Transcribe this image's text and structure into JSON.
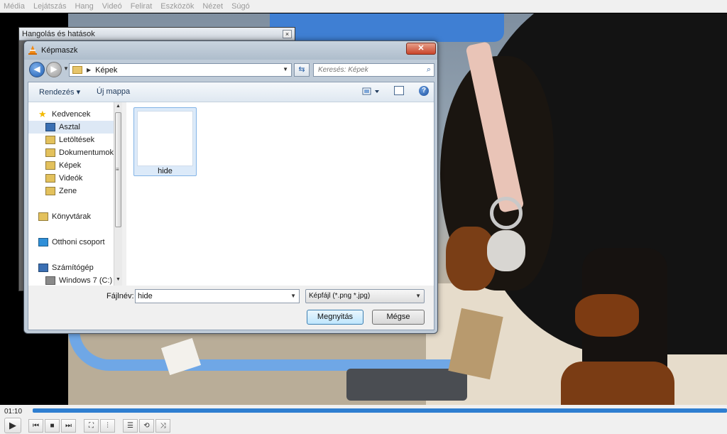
{
  "menubar": {
    "items": [
      "Média",
      "Lejátszás",
      "Hang",
      "Videó",
      "Felirat",
      "Eszközök",
      "Nézet",
      "Súgó"
    ]
  },
  "player": {
    "elapsed": "01:10",
    "progress_fraction": 1.0,
    "accent_color": "#2f7fd1",
    "buttons": {
      "play": "play-icon",
      "previous": "skip-previous-icon",
      "stop": "stop-icon",
      "next": "skip-next-icon",
      "fullscreen": "fullscreen-icon",
      "extended_settings": "equalizer-icon",
      "playlist": "playlist-icon",
      "loop": "loop-icon",
      "shuffle": "shuffle-icon"
    }
  },
  "effects_window": {
    "title": "Hangolás és hatások",
    "close": "×"
  },
  "dialog": {
    "title": "Képmaszk",
    "close": "✕",
    "address": "Képek",
    "search_placeholder": "Keresés: Képek",
    "toolbar": {
      "organize": "Rendezés ▾",
      "new_folder": "Új mappa"
    },
    "nav_items": [
      {
        "label": "Kedvencek",
        "icon": "star-icon",
        "indent": 0,
        "color": "#f2b900"
      },
      {
        "label": "Asztal",
        "icon": "desktop-icon",
        "indent": 1,
        "color": "#3a6fb3",
        "selected": true
      },
      {
        "label": "Letöltések",
        "icon": "downloads-folder-icon",
        "indent": 1,
        "color": "#e3c15c"
      },
      {
        "label": "Dokumentumok",
        "icon": "documents-folder-icon",
        "indent": 1,
        "color": "#e3c15c"
      },
      {
        "label": "Képek",
        "icon": "pictures-folder-icon",
        "indent": 1,
        "color": "#e3c15c"
      },
      {
        "label": "Videók",
        "icon": "videos-folder-icon",
        "indent": 1,
        "color": "#e3c15c"
      },
      {
        "label": "Zene",
        "icon": "music-folder-icon",
        "indent": 1,
        "color": "#e3c15c"
      },
      {
        "label": "Könyvtárak",
        "icon": "libraries-icon",
        "indent": 0,
        "color": "#e3c15c"
      },
      {
        "label": "Otthoni csoport",
        "icon": "homegroup-icon",
        "indent": 0,
        "color": "#2f8fd8"
      },
      {
        "label": "Számítógép",
        "icon": "computer-icon",
        "indent": 0,
        "color": "#3a6fb3"
      },
      {
        "label": "Windows 7 (C:)",
        "icon": "drive-icon",
        "indent": 1,
        "color": "#8a8a8a"
      }
    ],
    "files": [
      {
        "name": "hide",
        "selected": true
      }
    ],
    "filename_label": "Fájlnév:",
    "filename_value": "hide",
    "filetype": "Képfájl (*.png *.jpg)",
    "open_label": "Megnyitás",
    "cancel_label": "Mégse"
  }
}
